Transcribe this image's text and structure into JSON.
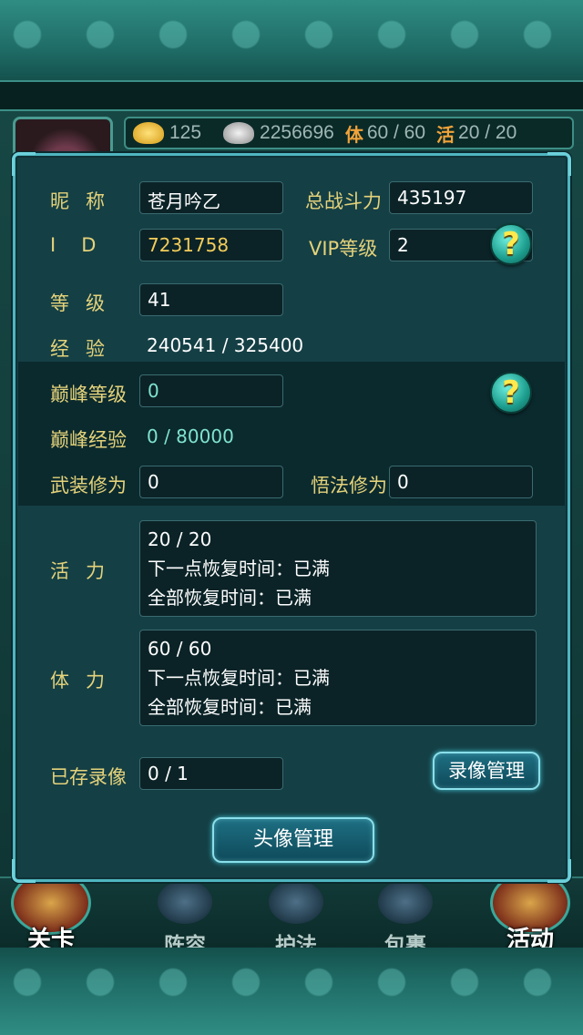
{
  "background": {
    "resources": {
      "gold": "125",
      "silver": "2256696",
      "stamina_tag": "体",
      "stamina": "60 / 60",
      "vitality_tag": "活",
      "vitality": "20 / 20"
    },
    "bottom_nav": {
      "stage": "关卡",
      "lineup": "阵容",
      "guardian": "护法",
      "bag": "包裹",
      "activity": "活动"
    }
  },
  "profile": {
    "nickname_label": "昵称",
    "nickname": "苍月吟乙",
    "power_label": "总战斗力",
    "power": "435197",
    "id_label": "ID",
    "id": "7231758",
    "vip_label": "VIP等级",
    "vip": "2",
    "level_label": "等级",
    "level": "41",
    "exp_label": "经验",
    "exp": "240541 / 325400",
    "peak_level_label": "巅峰等级",
    "peak_level": "0",
    "peak_exp_label": "巅峰经验",
    "peak_exp": "0 / 80000",
    "martial_label": "武装修为",
    "martial": "0",
    "dharma_label": "悟法修为",
    "dharma": "0",
    "vitality_label": "活力",
    "vitality": {
      "value": "20 / 20",
      "next": "下一点恢复时间：已满",
      "full": "全部恢复时间：已满"
    },
    "stamina_label": "体力",
    "stamina": {
      "value": "60 / 60",
      "next": "下一点恢复时间：已满",
      "full": "全部恢复时间：已满"
    },
    "replay_label": "已存录像",
    "replay": "0 / 1",
    "replay_button": "录像管理",
    "avatar_button": "头像管理",
    "help_icon": "?"
  },
  "colors": {
    "label": "#e4d27a",
    "value": "#ffffff",
    "id_value": "#f3cc5a",
    "peak_value": "#7fe3cf",
    "dialog_border": "#4fb6c0"
  }
}
